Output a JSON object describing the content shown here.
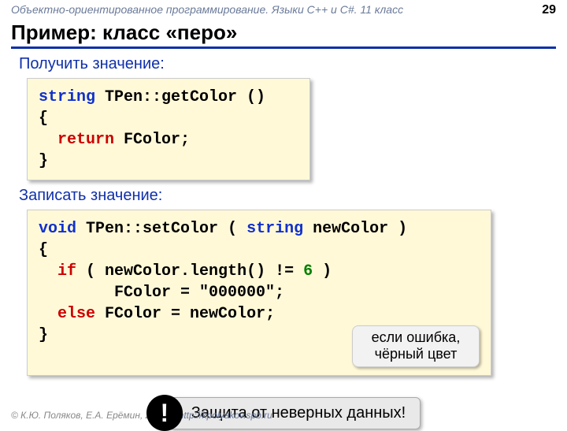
{
  "header": {
    "course": "Объектно-ориентированное программирование. Языки C++ и C#. 11 класс",
    "page": "29"
  },
  "title": "Пример: класс «перо»",
  "sections": {
    "get_label": "Получить значение:",
    "set_label": "Записать значение:"
  },
  "code": {
    "kw_string": "string",
    "getter_sig": " TPen::getColor ()",
    "brace_open": "{",
    "return_kw": "return",
    "getter_ret_rest": " FColor;",
    "brace_close": "}",
    "kw_void": "void",
    "setter_sig_a": " TPen::setColor ( ",
    "setter_sig_b_type": "string",
    "setter_sig_c": " newColor )",
    "if_kw": "if",
    "if_cond_a": " ( newColor.length() != ",
    "six": "6",
    "if_cond_b": " )",
    "assign_black": "        FColor = \"000000\";",
    "else_kw": "else",
    "assign_new": " FColor = newColor;"
  },
  "note": {
    "line1": "если ошибка,",
    "line2": "чёрный цвет"
  },
  "warning": {
    "icon": "!",
    "text": "Защита от неверных данных!"
  },
  "footer": {
    "authors": "© К.Ю. Поляков, Е.А. Ерёмин, 2014",
    "url": "http://kpolyakov.spb.ru"
  }
}
